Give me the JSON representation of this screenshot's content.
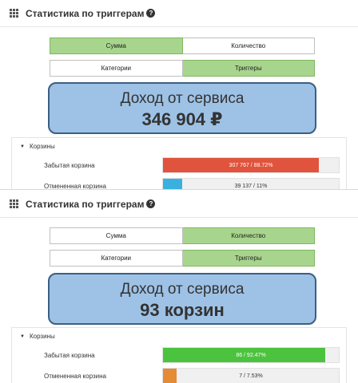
{
  "colors": {
    "toggle_active": "#a8d58d",
    "income_box_bg": "#9ec2e6",
    "income_box_border": "#3b5f82",
    "bar_red": "#e0533c",
    "bar_blue": "#3ab0e0",
    "bar_green": "#4cc33e",
    "bar_orange": "#e58a35"
  },
  "panels": [
    {
      "title": "Статистика по триггерам",
      "help_icon": "?",
      "mode_buttons": [
        {
          "label": "Сумма",
          "active": true
        },
        {
          "label": "Количество",
          "active": false
        }
      ],
      "group_buttons": [
        {
          "label": "Категории",
          "active": false
        },
        {
          "label": "Триггеры",
          "active": true
        }
      ],
      "income": {
        "title": "Доход от сервиса",
        "value": "346 904 ₽"
      },
      "section": {
        "title": "Корзины",
        "rows": [
          {
            "label": "Забытая корзина",
            "bar_text": "307 767 / 88.72%",
            "percent": 88.72,
            "color": "#e0533c"
          },
          {
            "label": "Отмененная корзина",
            "bar_text": "39 137 / 11%",
            "percent": 11,
            "color": "#3ab0e0"
          }
        ]
      }
    },
    {
      "title": "Статистика по триггерам",
      "help_icon": "?",
      "mode_buttons": [
        {
          "label": "Сумма",
          "active": false
        },
        {
          "label": "Количество",
          "active": true
        }
      ],
      "group_buttons": [
        {
          "label": "Категории",
          "active": false
        },
        {
          "label": "Триггеры",
          "active": true
        }
      ],
      "income": {
        "title": "Доход от сервиса",
        "value": "93 корзин"
      },
      "section": {
        "title": "Корзины",
        "rows": [
          {
            "label": "Забытая корзина",
            "bar_text": "86 / 92.47%",
            "percent": 92.47,
            "color": "#4cc33e"
          },
          {
            "label": "Отмененная корзина",
            "bar_text": "7 / 7.53%",
            "percent": 7.53,
            "color": "#e58a35"
          }
        ]
      }
    }
  ]
}
